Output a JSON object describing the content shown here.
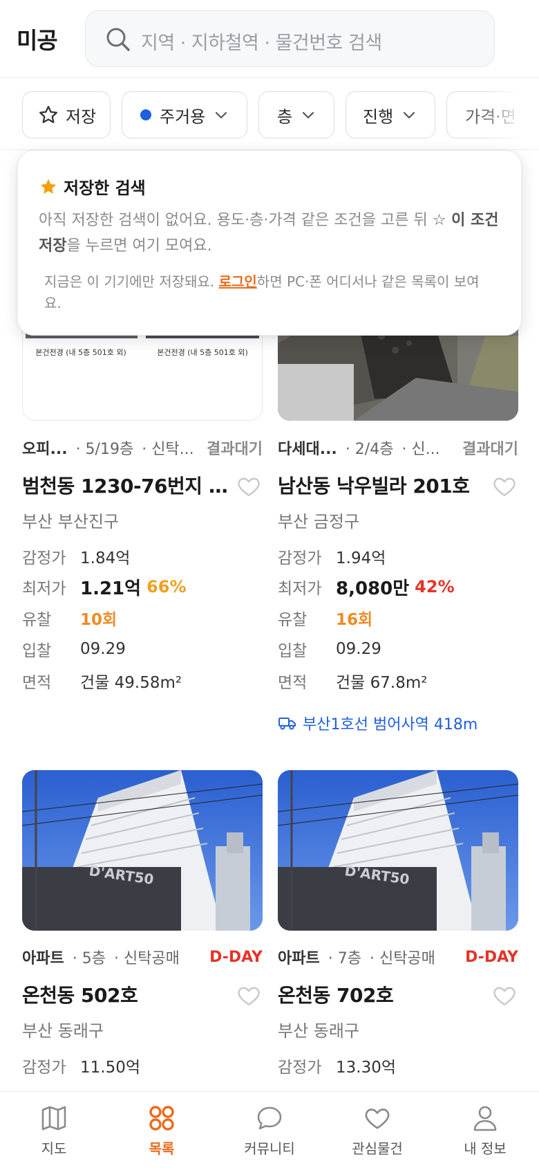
{
  "header": {
    "logo": "미공",
    "search_placeholder": "지역 · 지하철역 · 물건번호 검색",
    "search_icon": "search-icon"
  },
  "filters": {
    "save": "저장",
    "usage": "주거용",
    "floor": "층",
    "progress": "진행",
    "price": "가격·면"
  },
  "colors": {
    "accent": "#ea6a1c",
    "dday": "#e5332a",
    "subway": "#1f5fe0",
    "usage_dot": "#1f5fe0",
    "star": "#f5a00a"
  },
  "popover": {
    "title": "저장한 검색",
    "desc_prefix": "아직 저장한 검색이 없어요. 용도·층·가격 같은 조건을 고른 뒤 ",
    "desc_bold": "☆ 이 조건 저장",
    "desc_suffix": "을 누르면 여기 모여요.",
    "note_prefix": "지금은 이 기기에만 저장돼요. ",
    "note_link": "로그인",
    "note_suffix": "하면 PC·폰 어디서나 같은 목록이 보여요."
  },
  "labels": {
    "appraisal": "감정가",
    "minimum": "최저가",
    "failed": "유찰",
    "bid": "입찰",
    "area": "면적"
  },
  "listings": [
    {
      "type": "오피...",
      "floor": "· 5/19층",
      "kind": "· 신탁...",
      "status": "결과대기",
      "title": "범천동 1230-76번지 ...",
      "region": "부산 부산진구",
      "appraisal": "1.84억",
      "minimum": "1.21억",
      "percent": "66%",
      "failed": "10회",
      "bid": "09.29",
      "area": "건물 49.58m²",
      "photo_caption": "본건전경 (내 5층 501호 외)"
    },
    {
      "type": "다세대...",
      "floor": "· 2/4층",
      "kind": "· 신...",
      "status": "결과대기",
      "title": "남산동 낙우빌라 201호",
      "region": "부산 금정구",
      "appraisal": "1.94억",
      "minimum": "8,080만",
      "percent": "42%",
      "failed": "16회",
      "bid": "09.29",
      "area": "건물 67.8m²",
      "subway": "부산1호선 범어사역 418m"
    },
    {
      "type": "아파트",
      "floor": "· 5층",
      "kind": "· 신탁공매",
      "status": "D-DAY",
      "title": "온천동 502호",
      "region": "부산 동래구",
      "appraisal": "11.50억",
      "building_sign": "D'ART50"
    },
    {
      "type": "아파트",
      "floor": "· 7층",
      "kind": "· 신탁공매",
      "status": "D-DAY",
      "title": "온천동 702호",
      "region": "부산 동래구",
      "appraisal": "13.30억",
      "building_sign": "D'ART50"
    }
  ],
  "bottom_nav": [
    {
      "label": "지도",
      "icon": "map-icon"
    },
    {
      "label": "목록",
      "icon": "grid-icon",
      "active": true
    },
    {
      "label": "커뮤니티",
      "icon": "chat-icon"
    },
    {
      "label": "관심물건",
      "icon": "heart-icon"
    },
    {
      "label": "내 정보",
      "icon": "person-icon"
    }
  ]
}
